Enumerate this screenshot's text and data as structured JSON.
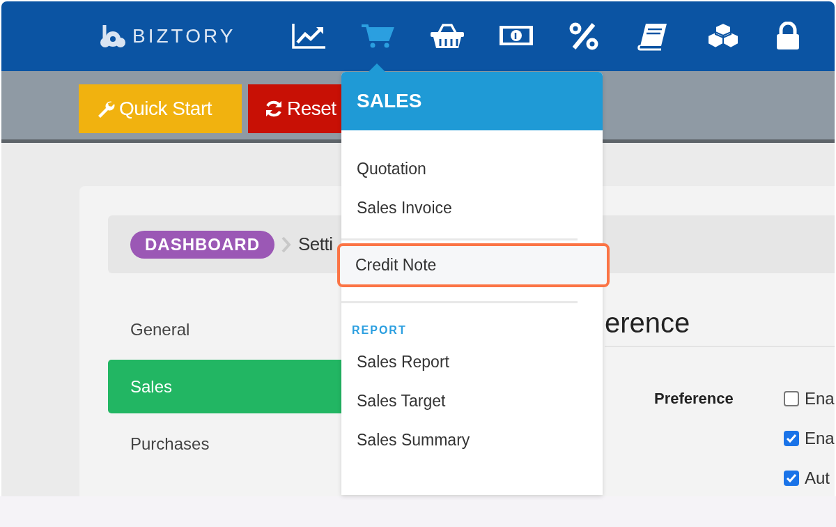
{
  "nav": {
    "logo": "BIZTORY",
    "items": [
      {
        "kind": "chart",
        "selected": false
      },
      {
        "kind": "cart",
        "selected": true
      },
      {
        "kind": "basket",
        "selected": false
      },
      {
        "kind": "banknote",
        "selected": false
      },
      {
        "kind": "percent",
        "selected": false
      },
      {
        "kind": "book",
        "selected": false
      },
      {
        "kind": "cubes",
        "selected": false
      },
      {
        "kind": "lock",
        "selected": false
      }
    ]
  },
  "toolbar": {
    "buttons": [
      {
        "kind": "quickstart",
        "label": "Quick Start"
      },
      {
        "kind": "reset",
        "label": "Reset"
      }
    ]
  },
  "breadcrumb": {
    "items": [
      "DASHBOARD",
      "Setti"
    ]
  },
  "sidebar": {
    "items": [
      {
        "label": "General",
        "selected": false
      },
      {
        "label": "Sales",
        "selected": true
      },
      {
        "label": "Purchases",
        "selected": false
      }
    ]
  },
  "content": {
    "heading": "erence",
    "section_label": "Preference",
    "options": [
      {
        "label": "Ena",
        "checked": false
      },
      {
        "label": "Ena",
        "checked": true
      },
      {
        "label": "Aut",
        "checked": true
      }
    ]
  },
  "dropdown": {
    "title": "SALES",
    "items": [
      {
        "kind": "link",
        "label": "Quotation",
        "selected": false
      },
      {
        "kind": "link",
        "label": "Sales Invoice",
        "selected": false
      },
      {
        "kind": "divider"
      },
      {
        "kind": "link",
        "label": "Credit Note",
        "selected": true
      },
      {
        "kind": "divider"
      },
      {
        "kind": "section",
        "label": "REPORT"
      },
      {
        "kind": "link",
        "label": "Sales Report",
        "selected": false
      },
      {
        "kind": "link",
        "label": "Sales Target",
        "selected": false
      },
      {
        "kind": "link",
        "label": "Sales Summary",
        "selected": false
      }
    ]
  }
}
